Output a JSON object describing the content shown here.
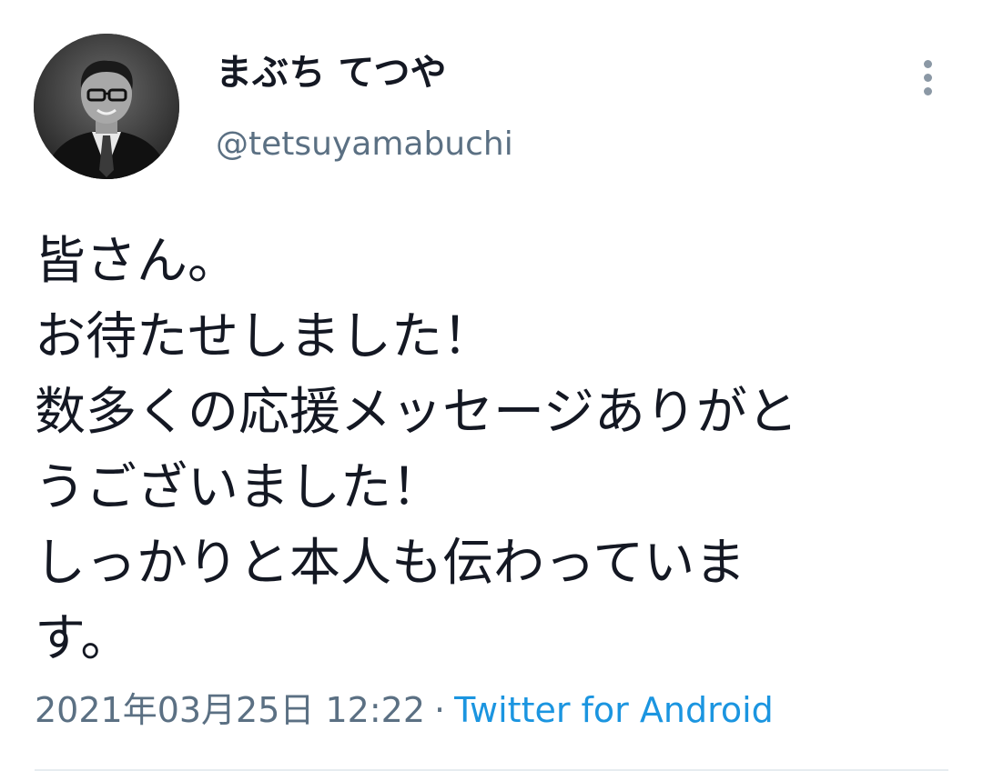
{
  "tweet": {
    "author": {
      "display_name": "まぶち てつや",
      "handle": "@tetsuyamabuchi",
      "avatar_icon": "profile-photo-avatar"
    },
    "menu_icon": "more-vertical-icon",
    "text_lines": [
      "皆さん。",
      "お待たせしました！",
      "数多くの応援メッセージありがと",
      "うございました！",
      "しっかりと本人も伝わっていま",
      "す。"
    ],
    "timestamp": "2021年03月25日 12:22",
    "separator": "·",
    "source": "Twitter for Android"
  },
  "colors": {
    "text_primary": "#141823",
    "text_secondary": "#5b7083",
    "link": "#1b95e0",
    "divider": "#e6ecf0"
  }
}
